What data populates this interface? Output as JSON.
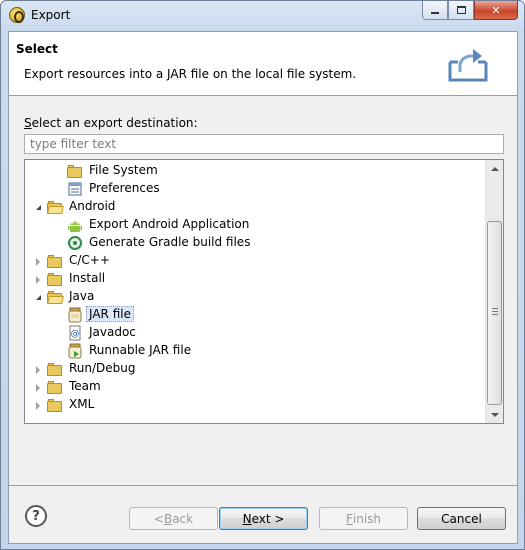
{
  "window": {
    "title": "Export",
    "controls": [
      "minimize",
      "maximize",
      "close"
    ]
  },
  "header": {
    "title": "Select",
    "description": "Export resources into a JAR file on the local file system."
  },
  "destination": {
    "label_prefix": "",
    "label_mnemonic": "S",
    "label_rest": "elect an export destination:",
    "filter_placeholder": "type filter text",
    "filter_value": ""
  },
  "tree": {
    "items": [
      {
        "label": "File System",
        "level": 1,
        "icon": "folder-icon",
        "expander": "none"
      },
      {
        "label": "Preferences",
        "level": 1,
        "icon": "preferences-icon",
        "expander": "none"
      },
      {
        "label": "Android",
        "level": 0,
        "icon": "folder-open-icon",
        "expander": "expanded"
      },
      {
        "label": "Export Android Application",
        "level": 1,
        "icon": "android-icon",
        "expander": "none"
      },
      {
        "label": "Generate Gradle build files",
        "level": 1,
        "icon": "gradle-icon",
        "expander": "none"
      },
      {
        "label": "C/C++",
        "level": 0,
        "icon": "folder-icon",
        "expander": "collapsed"
      },
      {
        "label": "Install",
        "level": 0,
        "icon": "folder-icon",
        "expander": "collapsed"
      },
      {
        "label": "Java",
        "level": 0,
        "icon": "folder-open-icon",
        "expander": "expanded"
      },
      {
        "label": "JAR file",
        "level": 1,
        "icon": "jar-icon",
        "expander": "none",
        "selected": true
      },
      {
        "label": "Javadoc",
        "level": 1,
        "icon": "javadoc-icon",
        "expander": "none"
      },
      {
        "label": "Runnable JAR file",
        "level": 1,
        "icon": "runnable-jar-icon",
        "expander": "none"
      },
      {
        "label": "Run/Debug",
        "level": 0,
        "icon": "folder-icon",
        "expander": "collapsed"
      },
      {
        "label": "Team",
        "level": 0,
        "icon": "folder-icon",
        "expander": "collapsed"
      },
      {
        "label": "XML",
        "level": 0,
        "icon": "folder-icon",
        "expander": "collapsed"
      }
    ]
  },
  "buttons": {
    "help": "?",
    "back_prefix": "< ",
    "back_mnemonic": "B",
    "back_rest": "ack",
    "next_prefix": "",
    "next_mnemonic": "N",
    "next_rest": "ext >",
    "finish_prefix": "",
    "finish_mnemonic": "F",
    "finish_rest": "inish",
    "cancel": "Cancel"
  },
  "colors": {
    "client_bg": "#f0f0f0",
    "selection_bg": "#d9e8fb",
    "default_button_border": "#3c7fb1"
  }
}
